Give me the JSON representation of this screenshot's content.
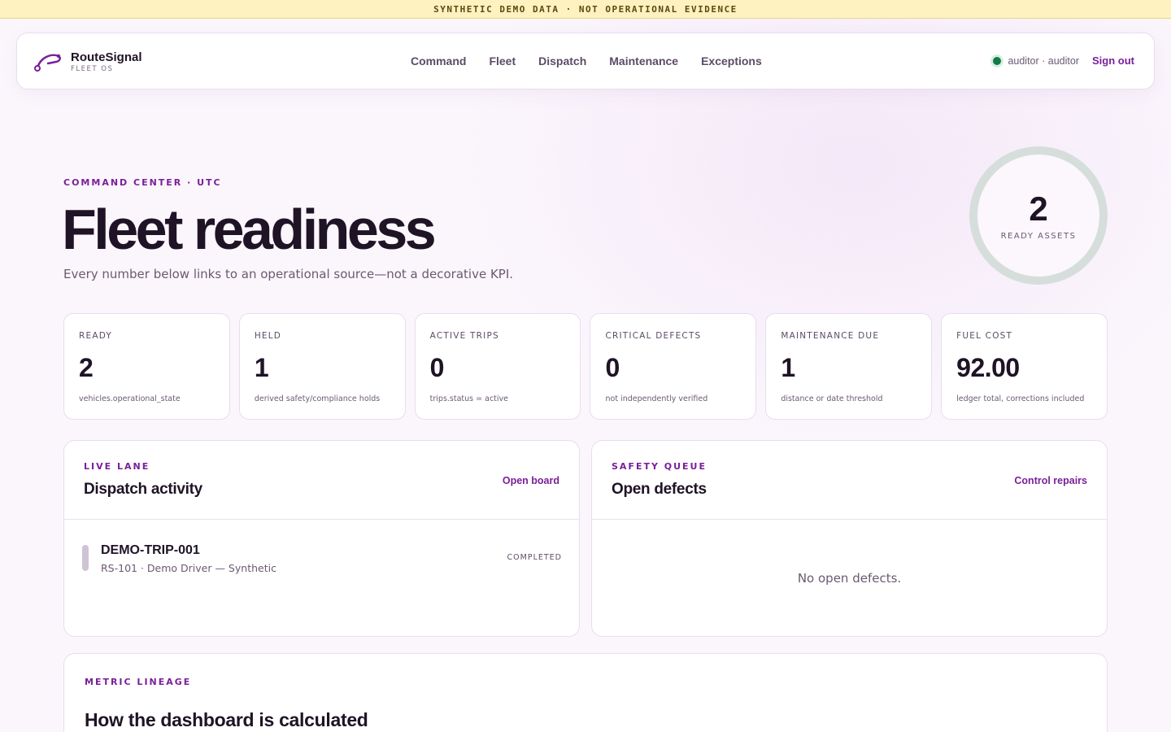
{
  "banner": {
    "text": "SYNTHETIC DEMO DATA · NOT OPERATIONAL EVIDENCE"
  },
  "brand": {
    "name": "RouteSignal",
    "sub": "FLEET OS"
  },
  "nav": {
    "items": [
      {
        "label": "Command"
      },
      {
        "label": "Fleet"
      },
      {
        "label": "Dispatch"
      },
      {
        "label": "Maintenance"
      },
      {
        "label": "Exceptions"
      }
    ],
    "user_label": "auditor · auditor",
    "status_color": "#157a46",
    "sign_out": "Sign out"
  },
  "hero": {
    "eyebrow": "COMMAND CENTER · UTC",
    "title": "Fleet readiness",
    "subtitle": "Every number below links to an operational source—not a decorative KPI."
  },
  "ring": {
    "value": "2",
    "label": "READY ASSETS"
  },
  "kpis": [
    {
      "label": "READY",
      "value": "2",
      "note": "vehicles.operational_state"
    },
    {
      "label": "HELD",
      "value": "1",
      "note": "derived safety/compliance holds"
    },
    {
      "label": "ACTIVE TRIPS",
      "value": "0",
      "note": "trips.status = active"
    },
    {
      "label": "CRITICAL DEFECTS",
      "value": "0",
      "note": "not independently verified"
    },
    {
      "label": "MAINTENANCE DUE",
      "value": "1",
      "note": "distance or date threshold"
    },
    {
      "label": "FUEL COST",
      "value": "92.00",
      "note": "ledger total, corrections included"
    }
  ],
  "dispatch": {
    "eyebrow": "LIVE LANE",
    "title": "Dispatch activity",
    "link": "Open board",
    "trips": [
      {
        "id": "DEMO-TRIP-001",
        "meta": "RS-101 · Demo Driver — Synthetic",
        "status": "COMPLETED"
      }
    ]
  },
  "defects": {
    "eyebrow": "SAFETY QUEUE",
    "title": "Open defects",
    "link": "Control repairs",
    "empty": "No open defects."
  },
  "lineage": {
    "eyebrow": "METRIC LINEAGE",
    "title": "How the dashboard is calculated"
  },
  "colors": {
    "accent": "#7a1f9a",
    "ink": "#1f1326",
    "banner": "#fdf2c0"
  }
}
